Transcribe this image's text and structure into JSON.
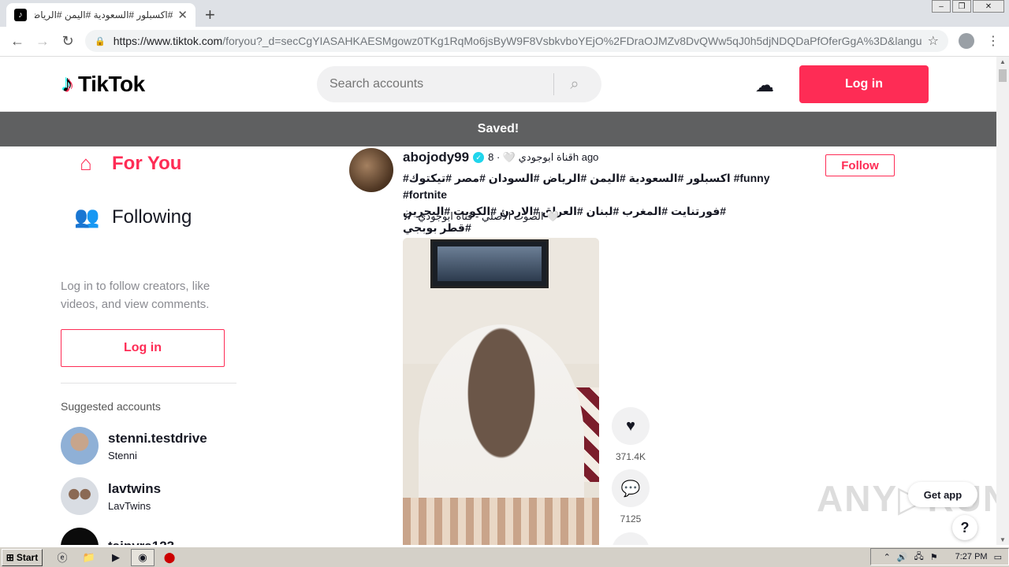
{
  "browser": {
    "tab_title": "#اكسبلور #السعودية #اليمن #الرياض",
    "url_host": "https://www.tiktok.com",
    "url_rest": "/foryou?_d=secCgYIASAHKAESMgowz0TKg1RqMo6jsByW9F8VsbkvboYEjO%2FDraOJMZv8DvQWw5qJ0h5djNDQDaPfOferGgA%3D&langua..."
  },
  "header": {
    "logo_text": "TikTok",
    "search_placeholder": "Search accounts",
    "login_label": "Log in"
  },
  "toast": "Saved!",
  "sidebar": {
    "nav": [
      {
        "label": "For You",
        "icon": "home-icon"
      },
      {
        "label": "Following",
        "icon": "people-icon"
      }
    ],
    "login_hint": "Log in to follow creators, like videos, and view comments.",
    "login_label": "Log in",
    "suggested_title": "Suggested accounts",
    "accounts": [
      {
        "username": "stenni.testdrive",
        "nickname": "Stenni"
      },
      {
        "username": "lavtwins",
        "nickname": "LavTwins"
      },
      {
        "username": "taipyra123",
        "nickname": ""
      }
    ]
  },
  "post": {
    "username": "abojody99",
    "meta": "قناة ابوجودي 🤍 · 8h ago",
    "follow_label": "Follow",
    "caption_line1": "#اكسبلور #السعودية #اليمن #الرياض #السودان #مصر #تيكتوك #funny #fortnite",
    "caption_line2": "#فورتنايت #المغرب #لبنان #العراق #الاردن #الكويت #البحرين #قطر بوبجي",
    "music": "الصوت الأصلي - قناة ابوجودي 🤍",
    "likes": "371.4K",
    "comments": "7125"
  },
  "floating": {
    "get_app": "Get app",
    "help": "?"
  },
  "taskbar": {
    "start_label": "Start",
    "clock": "7:27 PM"
  }
}
